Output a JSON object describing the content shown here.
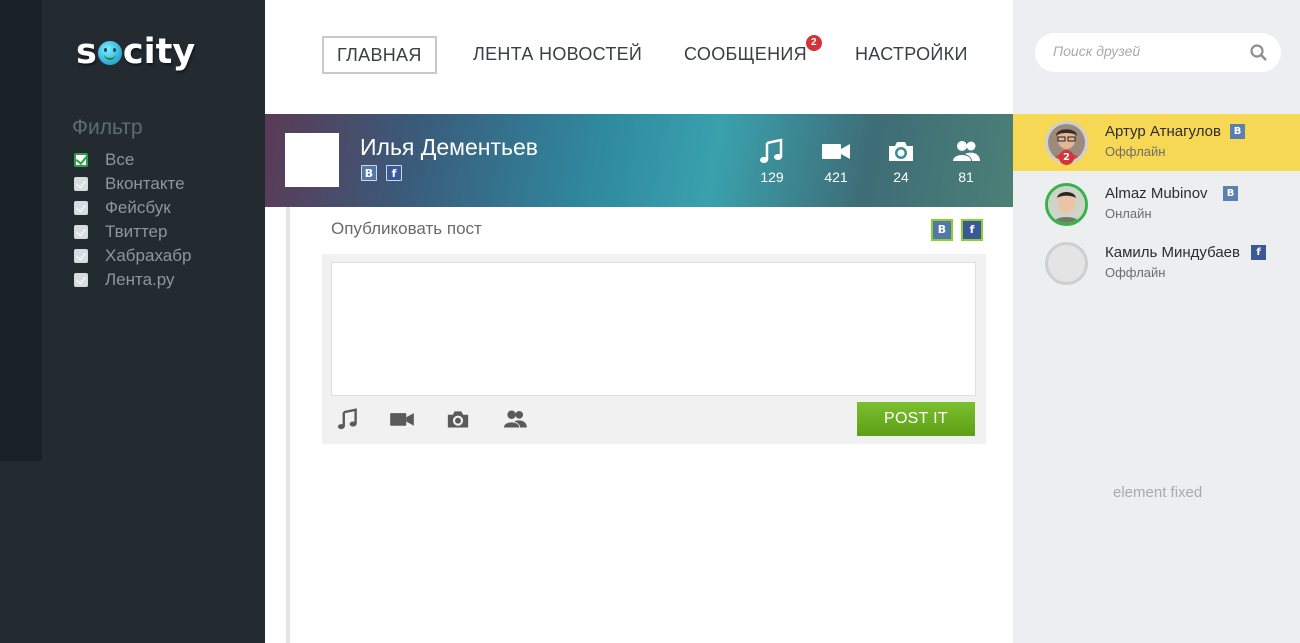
{
  "app": {
    "logo": "socity"
  },
  "filter": {
    "title": "Фильтр",
    "items": [
      {
        "label": "Все",
        "checked": true
      },
      {
        "label": "Вконтакте",
        "checked": false
      },
      {
        "label": "Фейсбук",
        "checked": false
      },
      {
        "label": "Твиттер",
        "checked": false
      },
      {
        "label": "Хабрахабр",
        "checked": false
      },
      {
        "label": "Лента.ру",
        "checked": false
      }
    ]
  },
  "nav": {
    "items": [
      {
        "label": "ГЛАВНАЯ",
        "active": true
      },
      {
        "label": "ЛЕНТА НОВОСТЕЙ",
        "active": false
      },
      {
        "label": "СООБЩЕНИЯ",
        "active": false,
        "badge": "2"
      },
      {
        "label": "НАСТРОЙКИ",
        "active": false
      }
    ]
  },
  "profile": {
    "name": "Илья Дементьев",
    "networks": {
      "vk": "B",
      "fb": "f"
    },
    "stats": [
      {
        "icon": "music-icon",
        "value": "129"
      },
      {
        "icon": "video-icon",
        "value": "421"
      },
      {
        "icon": "camera-icon",
        "value": "24"
      },
      {
        "icon": "friends-icon",
        "value": "81"
      }
    ]
  },
  "post": {
    "label": "Опубликовать пост",
    "vk_toggle": "B",
    "fb_toggle": "f",
    "text": "",
    "button": "POST IT",
    "tools": [
      "music-icon",
      "video-icon",
      "camera-icon",
      "friends-icon"
    ]
  },
  "friends": {
    "search_placeholder": "Поиск друзей",
    "list": [
      {
        "name": "Артур Атнагулов",
        "status": "Оффлайн",
        "network": "vk",
        "network_label": "B",
        "badge": "2",
        "active": true,
        "online": false
      },
      {
        "name": "Almaz Mubinov",
        "status": "Онлайн",
        "network": "vk",
        "network_label": "B",
        "active": false,
        "online": true
      },
      {
        "name": "Камиль Миндубаев",
        "status": "Оффлайн",
        "network": "fb",
        "network_label": "f",
        "active": false,
        "online": false
      }
    ],
    "fixed_note": "element fixed"
  },
  "colors": {
    "sidebar_bg": "#232b31",
    "accent_green": "#6aaf22",
    "active_friend_bg": "#f7d855",
    "badge_red": "#d4333a",
    "vk_blue": "#5277a8",
    "fb_blue": "#3b5998"
  }
}
